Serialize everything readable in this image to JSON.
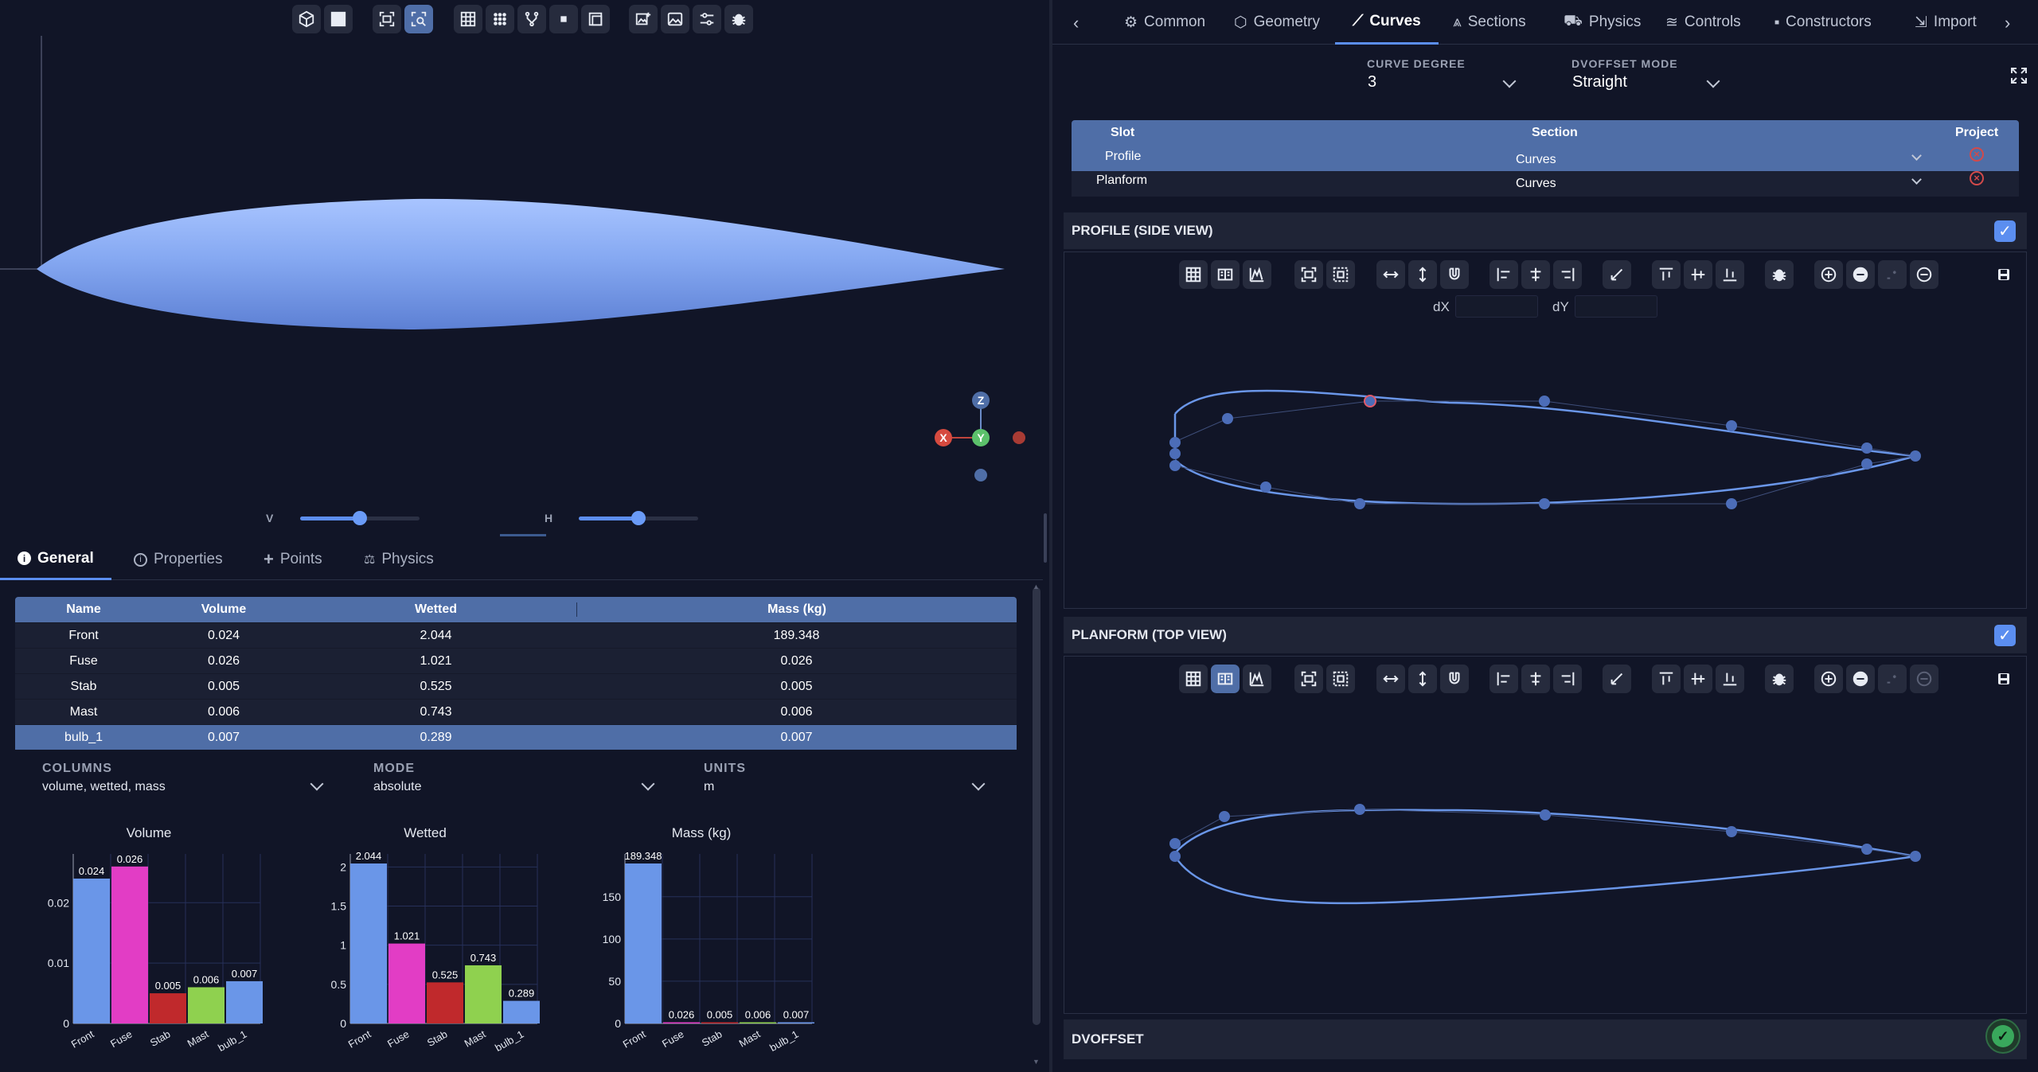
{
  "viewport": {
    "toolbar_icons": [
      "cube-icon",
      "grid-layout-icon",
      "fit-view-icon",
      "zoom-select-icon",
      "grid-icon",
      "points-icon",
      "branch-icon",
      "dot-icon",
      "frame-icon",
      "add-image-icon",
      "image-icon",
      "sliders-icon",
      "bug-icon"
    ],
    "active_tool": "zoom-select-icon",
    "slider_v_label": "V",
    "slider_h_label": "H",
    "slider_v_value": 0.5,
    "slider_h_value": 0.5,
    "gizmo": {
      "x": "X",
      "y": "Y",
      "z": "Z"
    }
  },
  "left_tabs": [
    {
      "label": "General",
      "icon": "info-icon",
      "active": true
    },
    {
      "label": "Properties",
      "icon": "info-outline-icon",
      "active": false
    },
    {
      "label": "Points",
      "icon": "plus-icon",
      "active": false
    },
    {
      "label": "Physics",
      "icon": "scale-icon",
      "active": false
    }
  ],
  "table": {
    "headers": [
      "Name",
      "Volume",
      "Wetted",
      "Mass (kg)"
    ],
    "rows": [
      [
        "Front",
        "0.024",
        "2.044",
        "189.348"
      ],
      [
        "Fuse",
        "0.026",
        "1.021",
        "0.026"
      ],
      [
        "Stab",
        "0.005",
        "0.525",
        "0.005"
      ],
      [
        "Mast",
        "0.006",
        "0.743",
        "0.006"
      ],
      [
        "bulb_1",
        "0.007",
        "0.289",
        "0.007"
      ]
    ],
    "selected_row": 4
  },
  "controls": {
    "columns_label": "COLUMNS",
    "columns_value": "volume, wetted, mass",
    "mode_label": "MODE",
    "mode_value": "absolute",
    "units_label": "UNITS",
    "units_value": "m"
  },
  "chart_data": [
    {
      "type": "bar",
      "title": "Volume",
      "categories": [
        "Front",
        "Fuse",
        "Stab",
        "Mast",
        "bulb_1"
      ],
      "values": [
        0.024,
        0.026,
        0.005,
        0.006,
        0.007
      ],
      "labels": [
        "0.024",
        "0.026",
        "0.005",
        "0.006",
        "0.007"
      ],
      "yticks": [
        "0",
        "0.01",
        "0.02"
      ],
      "ylim": [
        0,
        0.0265
      ],
      "colors": [
        "#6a96e8",
        "#e23dc5",
        "#c0292c",
        "#8fd14f",
        "#6a96e8"
      ]
    },
    {
      "type": "bar",
      "title": "Wetted",
      "categories": [
        "Front",
        "Fuse",
        "Stab",
        "Mast",
        "bulb_1"
      ],
      "values": [
        2.044,
        1.021,
        0.525,
        0.743,
        0.289
      ],
      "labels": [
        "2.044",
        "1.021",
        "0.525",
        "0.743",
        "0.289"
      ],
      "yticks": [
        "0",
        "0.5",
        "1",
        "1.5",
        "2"
      ],
      "ylim": [
        0,
        2.044
      ],
      "colors": [
        "#6a96e8",
        "#e23dc5",
        "#c0292c",
        "#8fd14f",
        "#6a96e8"
      ]
    },
    {
      "type": "bar",
      "title": "Mass (kg)",
      "categories": [
        "Front",
        "Fuse",
        "Stab",
        "Mast",
        "bulb_1"
      ],
      "values": [
        189.348,
        0.026,
        0.005,
        0.006,
        0.007
      ],
      "labels": [
        "189.348",
        "0.026",
        "0.005",
        "0.006",
        "0.007"
      ],
      "yticks": [
        "0",
        "50",
        "100",
        "150"
      ],
      "ylim": [
        0,
        189.348
      ],
      "colors": [
        "#6a96e8",
        "#e23dc5",
        "#c0292c",
        "#8fd14f",
        "#6a96e8"
      ]
    }
  ],
  "right_tabs": [
    {
      "label": "Common",
      "icon": "gear-icon",
      "active": false
    },
    {
      "label": "Geometry",
      "icon": "cube-icon",
      "active": false
    },
    {
      "label": "Curves",
      "icon": "chart-line-icon",
      "active": true
    },
    {
      "label": "Sections",
      "icon": "layers-icon",
      "active": false
    },
    {
      "label": "Physics",
      "icon": "weight-icon",
      "active": false
    },
    {
      "label": "Controls",
      "icon": "sliders-icon",
      "active": false
    },
    {
      "label": "Constructors",
      "icon": "square-icon",
      "active": false
    },
    {
      "label": "Import",
      "icon": "import-icon",
      "active": false
    }
  ],
  "curve_settings": {
    "degree_label": "CURVE DEGREE",
    "degree_value": "3",
    "dvoffset_label": "DVOFFSET MODE",
    "dvoffset_value": "Straight"
  },
  "slot_table": {
    "headers": [
      "Slot",
      "Section",
      "Project"
    ],
    "rows": [
      {
        "slot": "Profile",
        "section": "Curves"
      },
      {
        "slot": "Planform",
        "section": "Curves"
      }
    ],
    "selected_row": 0
  },
  "profile_panel": {
    "title": "PROFILE (SIDE VIEW)",
    "dx_label": "dX",
    "dy_label": "dY"
  },
  "planform_panel": {
    "title": "PLANFORM (TOP VIEW)"
  },
  "dvoffset_panel": {
    "title": "DVOFFSET"
  },
  "colors": {
    "accent": "#4f6ea7",
    "curve": "#6a96e8",
    "background": "#111527"
  }
}
